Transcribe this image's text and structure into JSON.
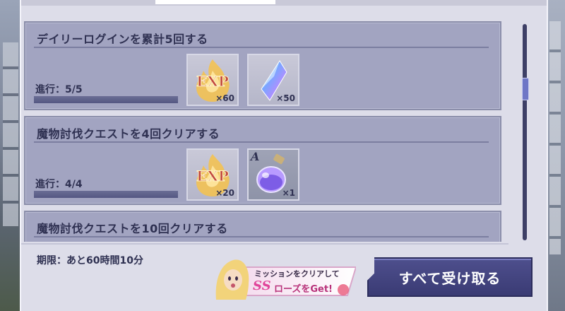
{
  "missions": [
    {
      "title": "デイリーログインを累計5回する",
      "progress_text": "進行：5/5",
      "progress": 1.0,
      "rewards": [
        {
          "icon": "exp-icon",
          "count": "×60"
        },
        {
          "icon": "crystal-icon",
          "count": "×50"
        }
      ]
    },
    {
      "title": "魔物討伐クエストを4回クリアする",
      "progress_text": "進行：4/4",
      "progress": 1.0,
      "rewards": [
        {
          "icon": "exp-icon",
          "count": "×20"
        },
        {
          "icon": "potion-icon",
          "rank": "A",
          "count": "×1"
        }
      ]
    },
    {
      "title": "魔物討伐クエストを10回クリアする",
      "progress_text": "",
      "progress": 0,
      "rewards": []
    }
  ],
  "footer": {
    "deadline": "期限：あと60時間10分",
    "claim_all_label": "すべて受け取る",
    "banner": {
      "line1": "ミッションをクリアして",
      "ss": "SS",
      "line2": "ローズをGet!"
    }
  },
  "colors": {
    "panel": "#dddde9",
    "card": "#a2a4c1",
    "text": "#2f3152",
    "button": "#3f4079"
  }
}
